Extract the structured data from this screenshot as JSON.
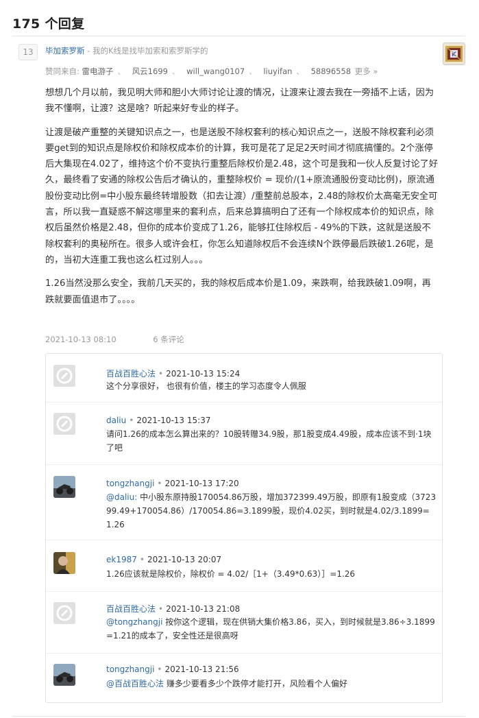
{
  "header": {
    "title": "175 个回复"
  },
  "reply": {
    "vote_count": "13",
    "author": "毕加索罗斯",
    "author_sep": " - ",
    "author_bio": "我的K线是找毕加索和索罗斯学的",
    "votes_label": "赞同来自:",
    "voters": [
      "雷电游子",
      "风云1699",
      "will_wang0107",
      "liuyifan",
      "58896558"
    ],
    "more": "更多 »",
    "paragraphs": [
      "想想几个月以前，我见明大师和胆小大师讨论让渡的情况，让渡来让渡去我在一旁插不上话，因为我不懂啊，让渡？这是啥？听起来好专业的样子。",
      "让渡是破产重整的关键知识点之一，也是送股不除权套利的核心知识点之一，送股不除权套利必须要get到的知识点是除权价和除权成本价的计算，我可是花了足足2天时间才彻底搞懂的。2个涨停后大集现在4.02了，维持这个价不变执行重整后除权价是2.48，这个可是我和一伙人反复讨论了好久，最终看了安通的除权公告后才确认的，重整除权价 = 现价/(1+原流通股份变动比例)，原流通股份变动比例=中小股东最终转增股数（扣去让渡）/重整前总股本，2.48的除权价太高毫无安全可言，所以我一直疑惑不解这哪里来的套利点，后来总算搞明白了还有一个除权成本价的知识点，除权后虽然价格是2.48，但你的成本价变成了1.26，能够扛住除权后 - 49%的下跌，这就是送股不除权套利的奥秘所在。很多人或许会杠，你怎么知道除权后不会连续N个跌停最后跌破1.26呢，是的，当初大连重工我也这么杠过别人。。。",
      "1.26当然没那么安全，我前几天买的，我的除权后成本价是1.09，来跌啊，给我跌破1.09啊，再跌就要面值退市了。。。。"
    ],
    "date": "2021-10-13 08:10",
    "comment_count": "6 条评论"
  },
  "comments": [
    {
      "user": "百战百胜心法",
      "time": "2021-10-13 15:24",
      "mention": "",
      "text": "这个分享很好， 也很有价值，楼主的学习态度令人佩服",
      "avatar": "default-avatar-icon"
    },
    {
      "user": "daliu",
      "time": "2021-10-13 15:37",
      "mention": "",
      "text": "请问1.26的成本怎么算出来的？10股转赠34.9股，那1股变成4.49股，成本应该不到·1块了吧",
      "avatar": "default-avatar-icon"
    },
    {
      "user": "tongzhangji",
      "time": "2021-10-13 17:20",
      "mention": "@daliu:",
      "text": " 中小股东原持股170054.86万股，增加372399.49万股，即原有1股变成（372399.49+170054.86）/170054.86=3.1899股，现价4.02买，到时就是4.02/3.1899=1.26",
      "avatar": "motorcycle-avatar"
    },
    {
      "user": "ek1987",
      "time": "2021-10-13 20:07",
      "mention": "",
      "text": "1.26应该就是除权价，除权价 = 4.02/［1+（3.49*0.63）］=1.26",
      "avatar": "person-avatar"
    },
    {
      "user": "百战百胜心法",
      "time": "2021-10-13 21:08",
      "mention": "@tongzhangji",
      "text": " 按你这个逻辑，现在供销大集价格3.86，买入，到时候就是3.86÷3.1899=1.21的成本了，安全性还是很高呀",
      "avatar": "default-avatar-icon"
    },
    {
      "user": "tongzhangji",
      "time": "2021-10-13 21:56",
      "mention": "@百战百胜心法",
      "text": " 赚多少要看多少个跌停才能打开，风险看个人偏好",
      "avatar": "motorcycle-avatar"
    }
  ],
  "colors": {
    "link": "#2e6aa5",
    "muted": "#999999",
    "text": "#333333"
  }
}
